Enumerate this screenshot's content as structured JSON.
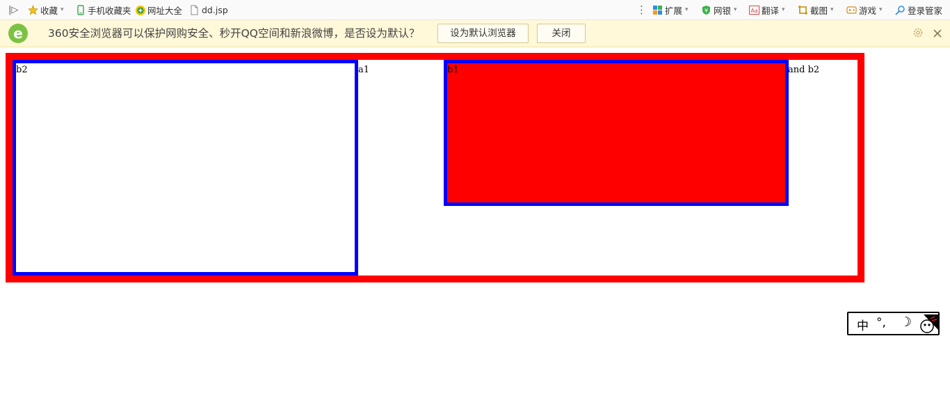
{
  "bookmarks_bar": {
    "sidebar_toggle": "|▷",
    "left_items": [
      {
        "label": "收藏",
        "icon": "star-icon",
        "has_chevron": true
      },
      {
        "label": "手机收藏夹",
        "icon": "phone-icon"
      },
      {
        "label": "网址大全",
        "icon": "web-directory-icon"
      },
      {
        "label": "dd.jsp",
        "icon": "page-icon"
      }
    ],
    "more": "⋮",
    "right_items": [
      {
        "label": "扩展",
        "icon": "extensions-icon"
      },
      {
        "label": "网银",
        "icon": "bank-shield-icon"
      },
      {
        "label": "翻译",
        "icon": "translate-icon"
      },
      {
        "label": "截图",
        "icon": "screenshot-icon"
      },
      {
        "label": "游戏",
        "icon": "game-icon"
      },
      {
        "label": "登录管家",
        "icon": "login-manager-icon"
      }
    ]
  },
  "infobar": {
    "logo": "e",
    "message": "360安全浏览器可以保护网购安全、秒开QQ空间和新浪微博，是否设为默认？",
    "set_default_label": "设为默认浏览器",
    "close_label": "关闭"
  },
  "page": {
    "b2_label": "b2",
    "a1_label": "a1",
    "b1_label": "b1",
    "and_b2_label": "and b2"
  },
  "ime": {
    "glyph_main": "中",
    "glyph_punct": "°,",
    "glyph_moon": "☽"
  },
  "colors": {
    "red": "#ff0000",
    "blue": "#0000ff",
    "infobar_bg": "#fff8d9"
  }
}
